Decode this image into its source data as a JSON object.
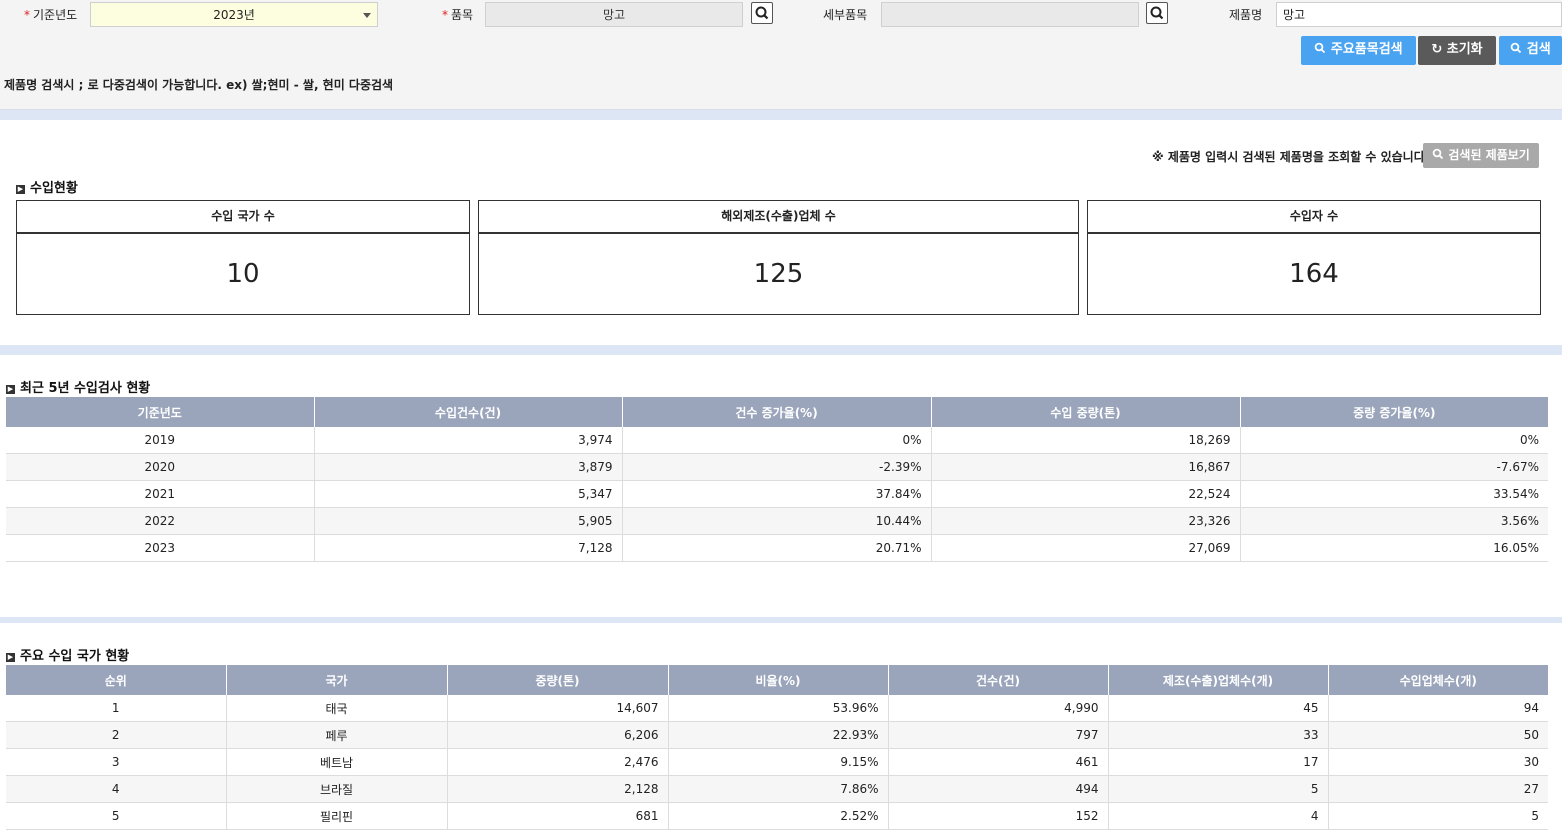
{
  "filters": {
    "year_label": "기준년도",
    "year_value": "2023년",
    "item_label": "품목",
    "item_value": "망고",
    "subitem_label": "세부품목",
    "subitem_value": "",
    "product_label": "제품명",
    "product_value": "망고",
    "required_mark": "*"
  },
  "buttons": {
    "major_search": "주요품목검색",
    "reset": "초기화",
    "search": "검색",
    "view_products": "검색된 제품보기"
  },
  "hint": "제품명 검색시 ; 로 다중검색이 가능합니다.  ex) 쌀;현미 - 쌀, 현미 다중검색",
  "notice": "※ 제품명 입력시 검색된 제품명을 조회할 수 있습니다.",
  "summary": {
    "title": "수입현황",
    "cards": [
      {
        "label": "수입 국가 수",
        "value": "10"
      },
      {
        "label": "해외제조(수출)업체 수",
        "value": "125"
      },
      {
        "label": "수입자 수",
        "value": "164"
      }
    ]
  },
  "five_year": {
    "title": "최근 5년 수입검사 현황",
    "headers": [
      "기준년도",
      "수입건수(건)",
      "건수 증가율(%)",
      "수입 중량(톤)",
      "중량 증가율(%)"
    ],
    "rows": [
      [
        "2019",
        "3,974",
        "0%",
        "18,269",
        "0%"
      ],
      [
        "2020",
        "3,879",
        "-2.39%",
        "16,867",
        "-7.67%"
      ],
      [
        "2021",
        "5,347",
        "37.84%",
        "22,524",
        "33.54%"
      ],
      [
        "2022",
        "5,905",
        "10.44%",
        "23,326",
        "3.56%"
      ],
      [
        "2023",
        "7,128",
        "20.71%",
        "27,069",
        "16.05%"
      ]
    ]
  },
  "countries": {
    "title": "주요 수입 국가 현황",
    "headers": [
      "순위",
      "국가",
      "중량(톤)",
      "비율(%)",
      "건수(건)",
      "제조(수출)업체수(개)",
      "수입업체수(개)"
    ],
    "rows": [
      [
        "1",
        "태국",
        "14,607",
        "53.96%",
        "4,990",
        "45",
        "94"
      ],
      [
        "2",
        "페루",
        "6,206",
        "22.93%",
        "797",
        "33",
        "50"
      ],
      [
        "3",
        "베트남",
        "2,476",
        "9.15%",
        "461",
        "17",
        "30"
      ],
      [
        "4",
        "브라질",
        "2,128",
        "7.86%",
        "494",
        "5",
        "27"
      ],
      [
        "5",
        "필리핀",
        "681",
        "2.52%",
        "152",
        "4",
        "5"
      ]
    ]
  }
}
